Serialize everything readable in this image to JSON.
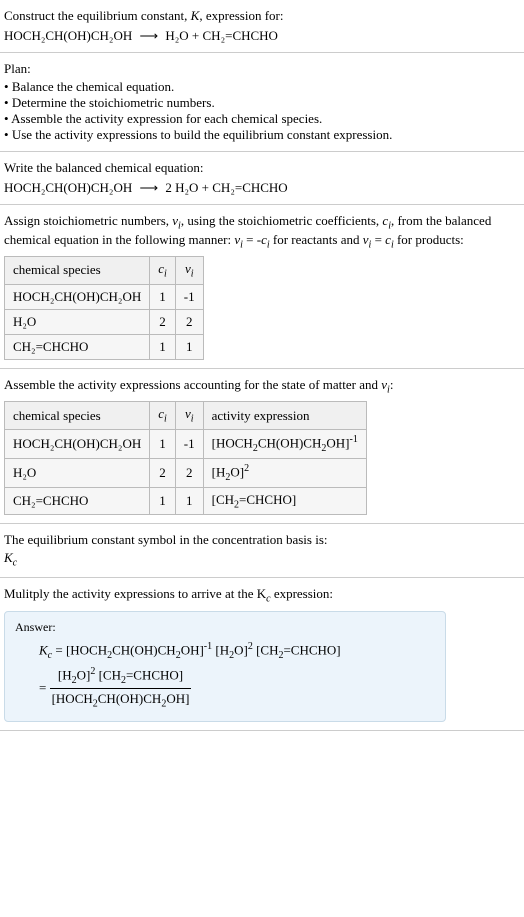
{
  "title_line1": "Construct the equilibrium constant, K, expression for:",
  "title_eq_lhs": "HOCH₂CH(OH)CH₂OH",
  "title_eq_rhs": "H₂O + CH₂=CHCHO",
  "plan_heading": "Plan:",
  "plan_items": [
    "Balance the chemical equation.",
    "Determine the stoichiometric numbers.",
    "Assemble the activity expression for each chemical species.",
    "Use the activity expressions to build the equilibrium constant expression."
  ],
  "balanced_heading": "Write the balanced chemical equation:",
  "balanced_lhs": "HOCH₂CH(OH)CH₂OH",
  "balanced_rhs": "2 H₂O + CH₂=CHCHO",
  "stoich_text1": "Assign stoichiometric numbers, νᵢ, using the stoichiometric coefficients, cᵢ, from the balanced chemical equation in the following manner: νᵢ = -cᵢ for reactants and νᵢ = cᵢ for products:",
  "table1": {
    "headers": [
      "chemical species",
      "cᵢ",
      "νᵢ"
    ],
    "rows": [
      [
        "HOCH₂CH(OH)CH₂OH",
        "1",
        "-1"
      ],
      [
        "H₂O",
        "2",
        "2"
      ],
      [
        "CH₂=CHCHO",
        "1",
        "1"
      ]
    ]
  },
  "activity_heading": "Assemble the activity expressions accounting for the state of matter and νᵢ:",
  "table2": {
    "headers": [
      "chemical species",
      "cᵢ",
      "νᵢ",
      "activity expression"
    ],
    "rows": [
      [
        "HOCH₂CH(OH)CH₂OH",
        "1",
        "-1",
        "[HOCH₂CH(OH)CH₂OH]⁻¹"
      ],
      [
        "H₂O",
        "2",
        "2",
        "[H₂O]²"
      ],
      [
        "CH₂=CHCHO",
        "1",
        "1",
        "[CH₂=CHCHO]"
      ]
    ]
  },
  "symbol_text": "The equilibrium constant symbol in the concentration basis is:",
  "symbol_kc": "K",
  "symbol_kc_sub": "c",
  "multiply_text": "Mulitply the activity expressions to arrive at the K",
  "multiply_text_end": " expression:",
  "answer_label": "Answer:",
  "answer_line1_lhs": "K",
  "answer_line1_lhs_sub": "c",
  "answer_line1_rhs": "= [HOCH₂CH(OH)CH₂OH]⁻¹ [H₂O]² [CH₂=CHCHO]",
  "answer_line2_num": "[H₂O]² [CH₂=CHCHO]",
  "answer_line2_den": "[HOCH₂CH(OH)CH₂OH]",
  "arrow": "⟶",
  "chart_data": {
    "type": "table",
    "stoichiometry": [
      {
        "species": "HOCH2CH(OH)CH2OH",
        "c_i": 1,
        "nu_i": -1
      },
      {
        "species": "H2O",
        "c_i": 2,
        "nu_i": 2
      },
      {
        "species": "CH2=CHCHO",
        "c_i": 1,
        "nu_i": 1
      }
    ],
    "activity": [
      {
        "species": "HOCH2CH(OH)CH2OH",
        "c_i": 1,
        "nu_i": -1,
        "activity": "[HOCH2CH(OH)CH2OH]^-1"
      },
      {
        "species": "H2O",
        "c_i": 2,
        "nu_i": 2,
        "activity": "[H2O]^2"
      },
      {
        "species": "CH2=CHCHO",
        "c_i": 1,
        "nu_i": 1,
        "activity": "[CH2=CHCHO]"
      }
    ]
  }
}
